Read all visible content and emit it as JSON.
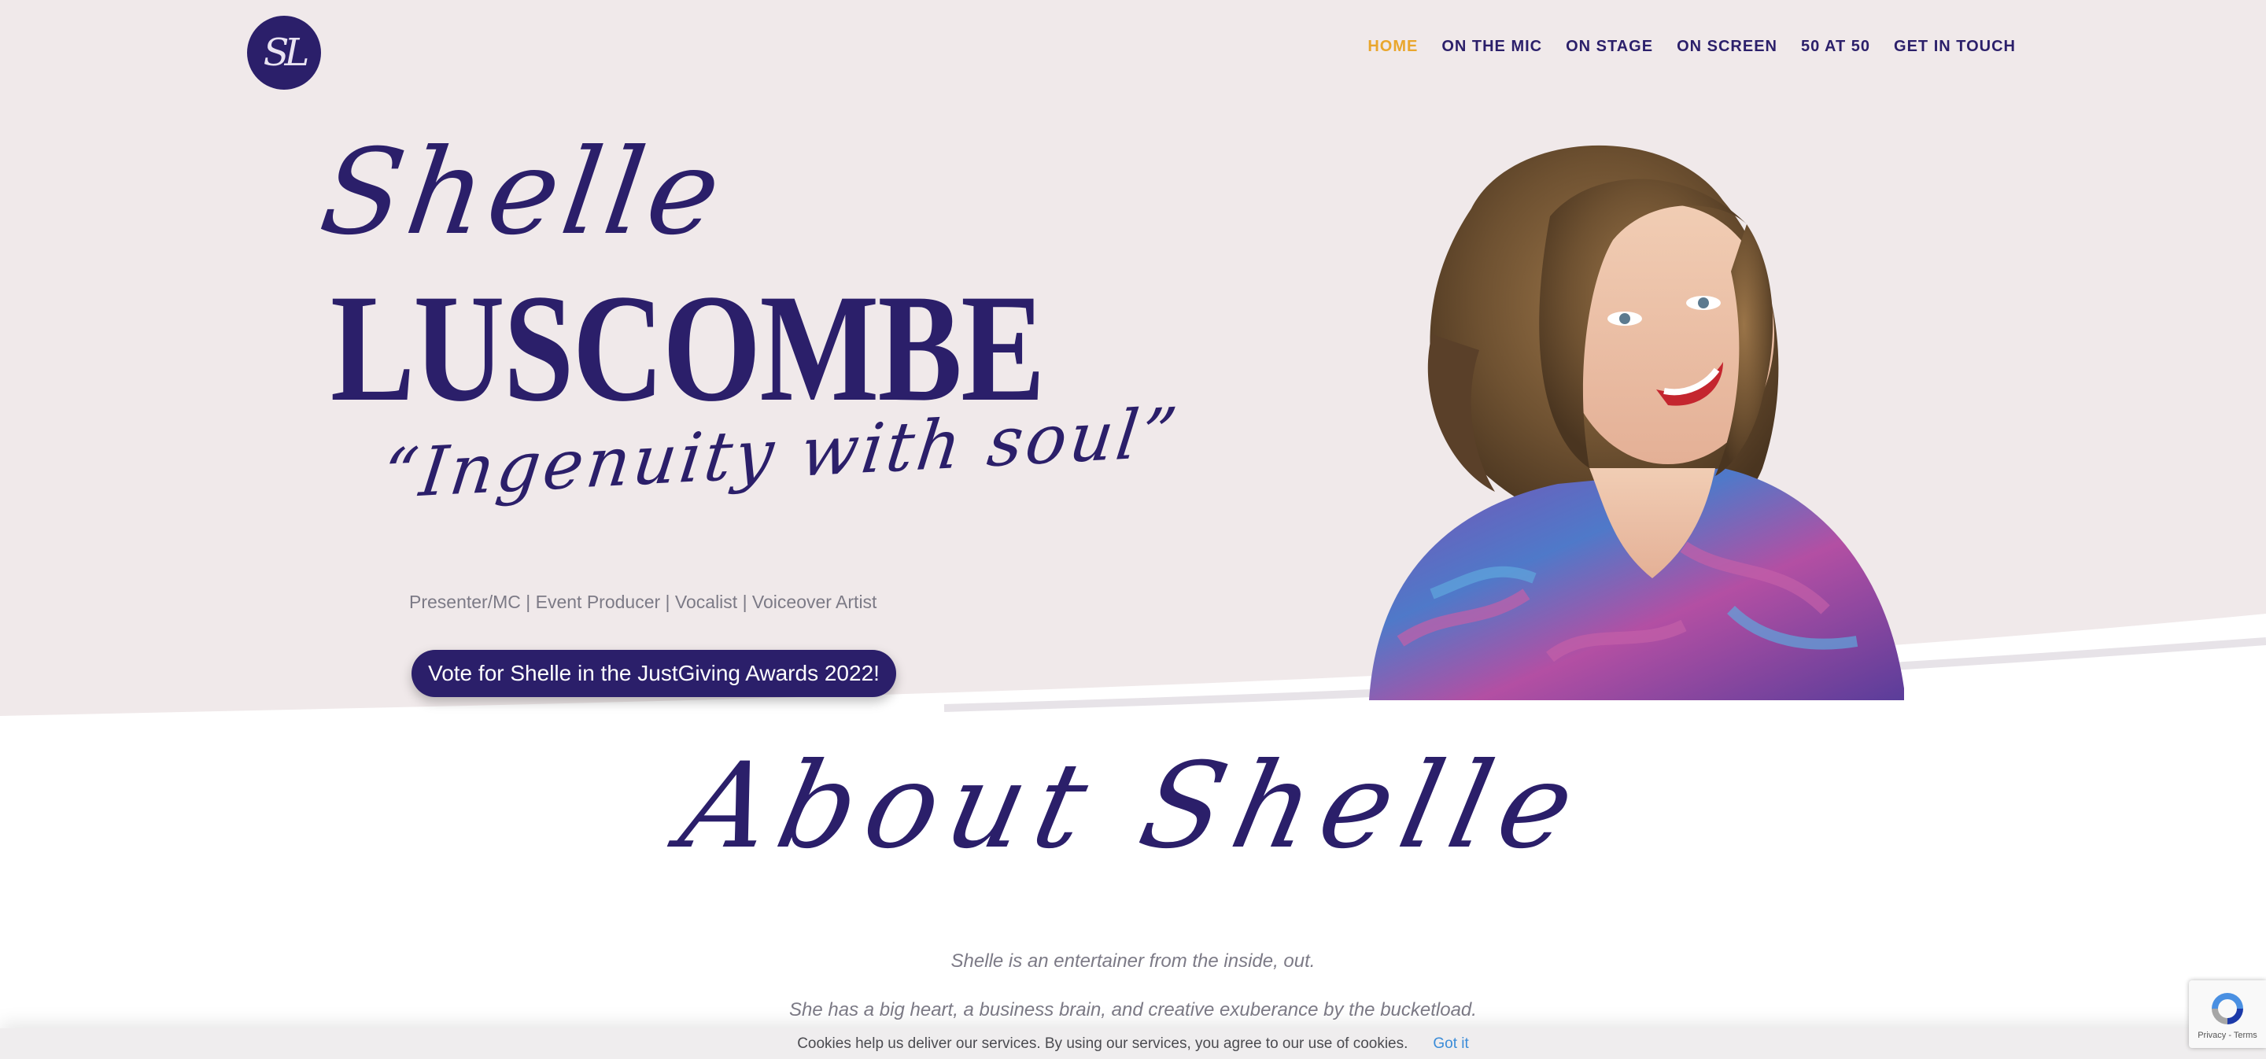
{
  "header": {
    "logo_text": "SL",
    "nav": [
      {
        "label": "HOME",
        "active": true
      },
      {
        "label": "ON THE MIC",
        "active": false
      },
      {
        "label": "ON STAGE",
        "active": false
      },
      {
        "label": "ON SCREEN",
        "active": false
      },
      {
        "label": "50 AT 50",
        "active": false
      },
      {
        "label": "GET IN TOUCH",
        "active": false
      }
    ]
  },
  "hero": {
    "first_name": "Shelle",
    "last_name": "LUSCOMBE",
    "tagline": "“Ingenuity with soul”",
    "roles": "Presenter/MC | Event Producer | Vocalist | Voiceover Artist",
    "cta_label": "Vote for Shelle in the JustGiving Awards 2022!"
  },
  "about": {
    "title": "About Shelle",
    "line1": "Shelle is an entertainer from the inside, out.",
    "line2": "She has a big heart, a business brain, and creative exuberance by the bucketload."
  },
  "cookie_bar": {
    "message": "Cookies help us deliver our services. By using our services, you agree to our use of cookies.",
    "accept_label": "Got it"
  },
  "recaptcha": {
    "legal": "Privacy - Terms"
  },
  "colors": {
    "brand_purple": "#2b1f6a",
    "active_nav": "#e9a62c",
    "hero_bg": "#f0e9ea",
    "muted_text": "#7c7a86",
    "link_blue": "#3b8cd8"
  },
  "icons": {
    "logo": "monogram-logo",
    "portrait": "portrait-photo",
    "recaptcha": "recaptcha-icon"
  }
}
